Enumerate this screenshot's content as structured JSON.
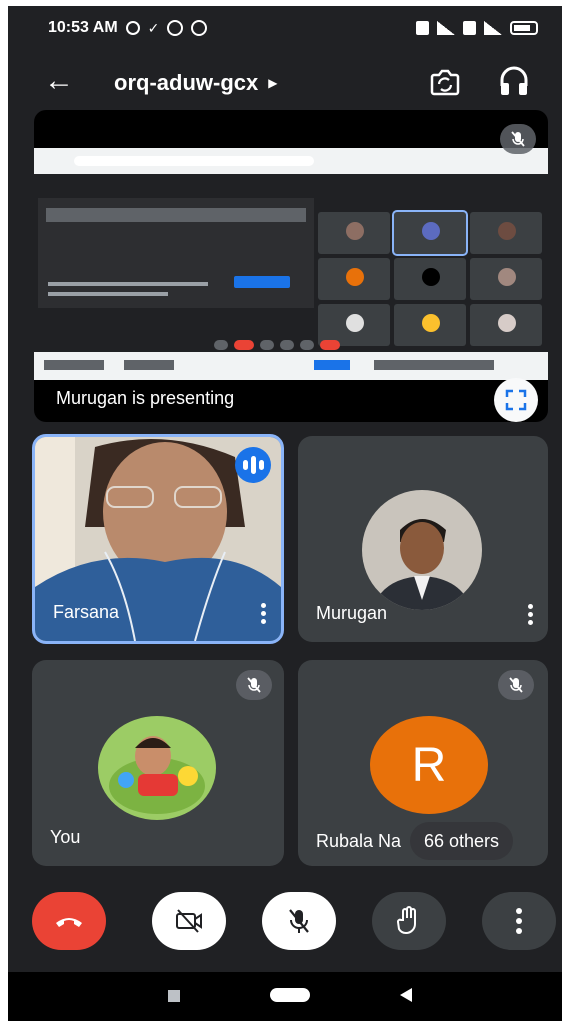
{
  "status_bar": {
    "time": "10:53 AM"
  },
  "header": {
    "meeting_code": "orq-aduw-gcx"
  },
  "presentation": {
    "presenting_text": "Murugan is presenting"
  },
  "participants": {
    "farsana": {
      "name": "Farsana"
    },
    "murugan": {
      "name": "Murugan"
    },
    "you": {
      "name": "You"
    },
    "rubala": {
      "name": "Rubala Na",
      "initial": "R"
    },
    "others": {
      "label": "66 others"
    }
  },
  "colors": {
    "background": "#202124",
    "tile": "#3c4043",
    "accent": "#8ab4f8",
    "end_call": "#ea4335",
    "avatar_orange": "#e8710a"
  },
  "icons": {
    "back": "arrow-left-icon",
    "switch_camera": "switch-camera-icon",
    "audio": "headphones-icon",
    "fullscreen": "fullscreen-icon",
    "muted": "mic-off-icon",
    "end_call": "phone-hangup-icon",
    "camera": "camera-off-icon",
    "mic": "mic-off-icon",
    "raise_hand": "hand-icon",
    "more": "more-vertical-icon"
  }
}
